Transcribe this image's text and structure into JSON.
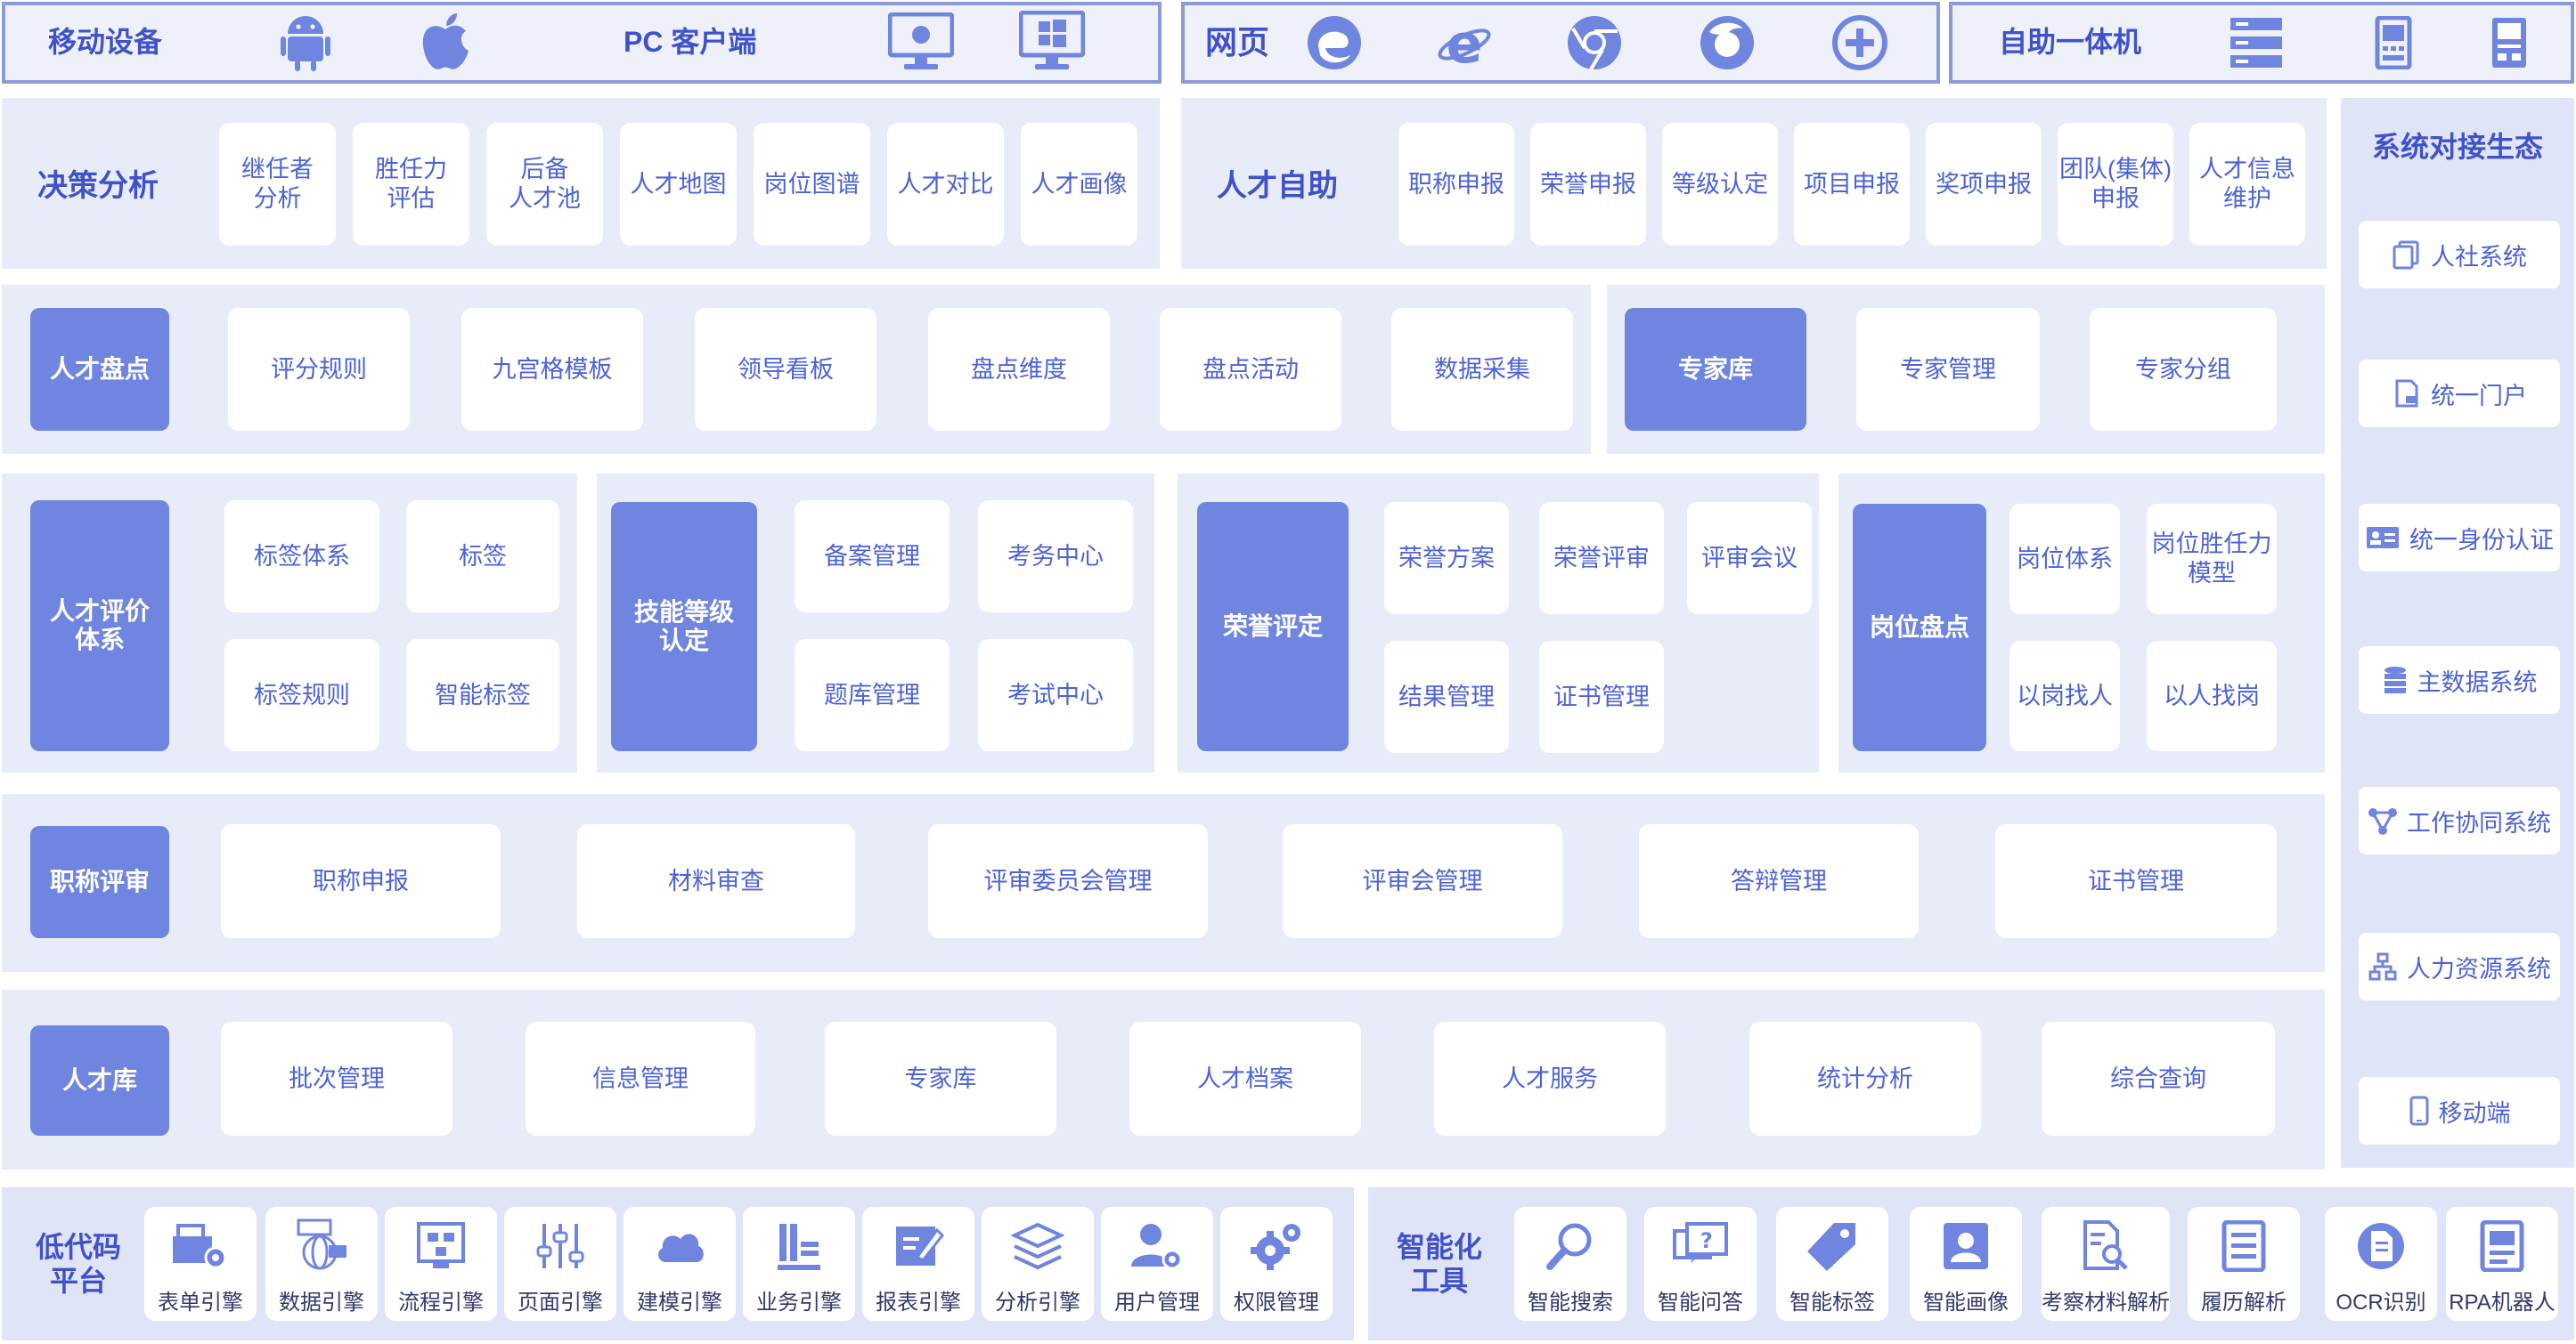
{
  "colors": {
    "accent": "#6f85e0",
    "text": "#4d63d6",
    "panel": "#e8ecf8",
    "border": "#8c9ad9"
  },
  "top": {
    "mobile_title": "移动设备",
    "pc_title": "PC 客户端",
    "web_title": "网页",
    "kiosk_title": "自助一体机"
  },
  "decision": {
    "title": "决策分析",
    "items": [
      "继任者\n分析",
      "胜任力\n评估",
      "后备\n人才池",
      "人才地图",
      "岗位图谱",
      "人才对比",
      "人才画像"
    ]
  },
  "selfservice": {
    "title": "人才自助",
    "items": [
      "职称申报",
      "荣誉申报",
      "等级认定",
      "项目申报",
      "奖项申报",
      "团队(集体)\n申报",
      "人才信息\n维护"
    ]
  },
  "inventory": {
    "head": "人才盘点",
    "items": [
      "评分规则",
      "九宫格模板",
      "领导看板",
      "盘点维度",
      "盘点活动",
      "数据采集"
    ]
  },
  "expert": {
    "head": "专家库",
    "items": [
      "专家管理",
      "专家分组"
    ]
  },
  "evaluation": {
    "head": "人才评价\n体系",
    "items": [
      "标签体系",
      "标签",
      "标签规则",
      "智能标签"
    ]
  },
  "skill": {
    "head": "技能等级\n认定",
    "items": [
      "备案管理",
      "考务中心",
      "题库管理",
      "考试中心"
    ]
  },
  "honor": {
    "head": "荣誉评定",
    "items": [
      "荣誉方案",
      "荣誉评审",
      "评审会议",
      "结果管理",
      "证书管理"
    ]
  },
  "post": {
    "head": "岗位盘点",
    "items": [
      "岗位体系",
      "岗位胜任力\n模型",
      "以岗找人",
      "以人找岗"
    ]
  },
  "title_review": {
    "head": "职称评审",
    "items": [
      "职称申报",
      "材料审查",
      "评审委员会管理",
      "评审会管理",
      "答辩管理",
      "证书管理"
    ]
  },
  "talent_lib": {
    "head": "人才库",
    "items": [
      "批次管理",
      "信息管理",
      "专家库",
      "人才档案",
      "人才服务",
      "统计分析",
      "综合查询"
    ]
  },
  "ecosystem": {
    "title": "系统对接生态",
    "items": [
      "人社系统",
      "统一门户",
      "统一身份认证",
      "主数据系统",
      "工作协同系统",
      "人力资源系统",
      "移动端"
    ]
  },
  "lowcode": {
    "title": "低代码\n平台",
    "items": [
      "表单引擎",
      "数据引擎",
      "流程引擎",
      "页面引擎",
      "建模引擎",
      "业务引擎",
      "报表引擎",
      "分析引擎",
      "用户管理",
      "权限管理"
    ]
  },
  "smart": {
    "title": "智能化\n工具",
    "items": [
      "智能搜索",
      "智能问答",
      "智能标签",
      "智能画像",
      "考察材料解析",
      "履历解析",
      "OCR识别",
      "RPA机器人"
    ]
  }
}
